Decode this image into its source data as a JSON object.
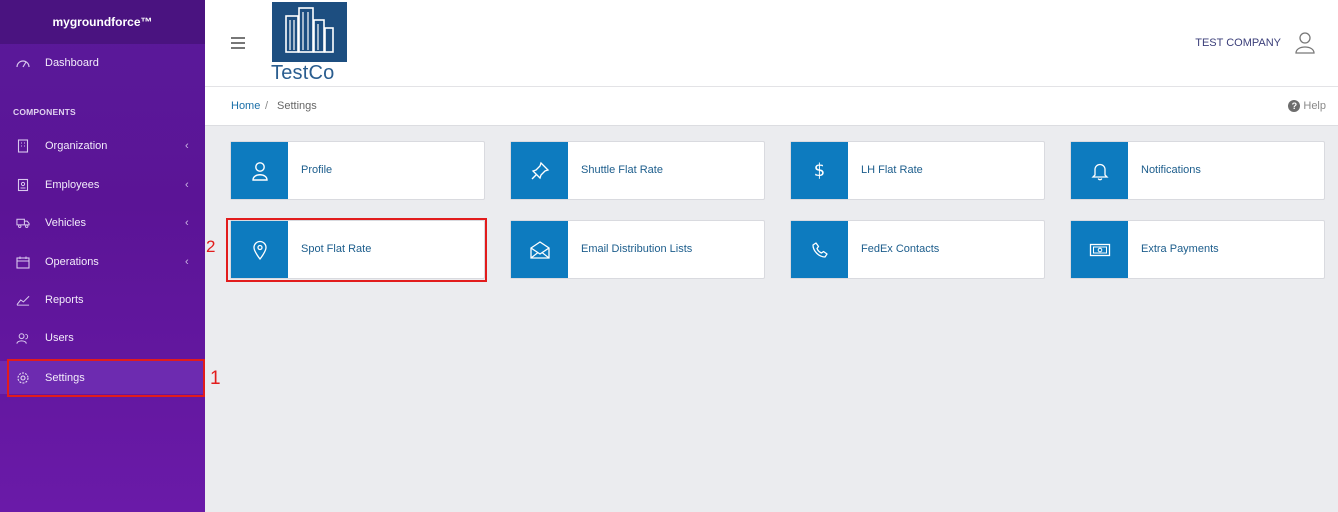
{
  "sidebar": {
    "brand": "mygroundforce™",
    "section_title": "COMPONENTS",
    "items": [
      {
        "label": "Dashboard",
        "icon": "dashboard-icon"
      },
      {
        "label": "Organization",
        "icon": "building-icon",
        "chevron": "‹"
      },
      {
        "label": "Employees",
        "icon": "id-badge-icon",
        "chevron": "‹"
      },
      {
        "label": "Vehicles",
        "icon": "truck-icon",
        "chevron": "‹"
      },
      {
        "label": "Operations",
        "icon": "calendar-icon",
        "chevron": "‹"
      },
      {
        "label": "Reports",
        "icon": "chart-line-icon"
      },
      {
        "label": "Users",
        "icon": "users-icon"
      },
      {
        "label": "Settings",
        "icon": "gear-icon",
        "active": true
      }
    ]
  },
  "header": {
    "logo_text": "TestCo",
    "company": "TEST COMPANY"
  },
  "breadcrumb": {
    "home": "Home",
    "separator": "/",
    "current": "Settings",
    "help": "Help"
  },
  "cards": [
    {
      "label": "Profile",
      "icon": "user-icon"
    },
    {
      "label": "Shuttle Flat Rate",
      "icon": "pin-icon"
    },
    {
      "label": "LH Flat Rate",
      "icon": "dollar-icon"
    },
    {
      "label": "Notifications",
      "icon": "bell-icon"
    },
    {
      "label": "Spot Flat Rate",
      "icon": "map-marker-icon"
    },
    {
      "label": "Email Distribution Lists",
      "icon": "envelope-open-icon"
    },
    {
      "label": "FedEx Contacts",
      "icon": "phone-icon"
    },
    {
      "label": "Extra Payments",
      "icon": "money-icon"
    }
  ],
  "annotations": {
    "step1": "1",
    "step2": "2"
  },
  "colors": {
    "sidebar": "#5b1496",
    "tile": "#0d7bbf",
    "highlight": "#e21c1c"
  }
}
